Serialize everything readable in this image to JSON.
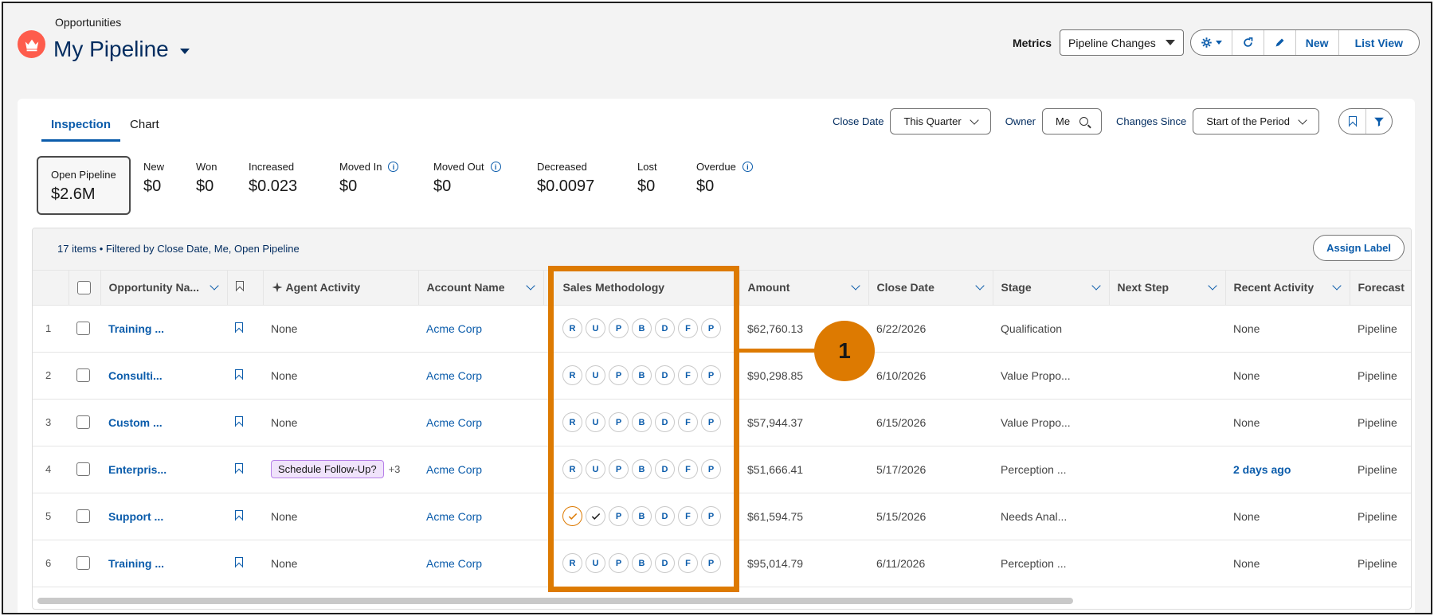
{
  "header": {
    "breadcrumb": "Opportunities",
    "title": "My Pipeline",
    "metrics_label": "Metrics",
    "metrics_value": "Pipeline Changes",
    "new_label": "New",
    "list_view_label": "List View"
  },
  "tabs": [
    {
      "label": "Inspection",
      "active": true
    },
    {
      "label": "Chart",
      "active": false
    }
  ],
  "filters": {
    "close_date_label": "Close Date",
    "close_date_value": "This Quarter",
    "owner_label": "Owner",
    "owner_value": "Me",
    "changes_since_label": "Changes Since",
    "changes_since_value": "Start of the Period"
  },
  "kpis": [
    {
      "label": "Open Pipeline",
      "value": "$2.6M"
    },
    {
      "label": "New",
      "value": "$0"
    },
    {
      "label": "Won",
      "value": "$0"
    },
    {
      "label": "Increased",
      "value": "$0.023"
    },
    {
      "label": "Moved In",
      "value": "$0"
    },
    {
      "label": "Moved Out",
      "value": "$0"
    },
    {
      "label": "Decreased",
      "value": "$0.0097"
    },
    {
      "label": "Lost",
      "value": "$0"
    },
    {
      "label": "Overdue",
      "value": "$0"
    }
  ],
  "table": {
    "summary": "17 items • Filtered by Close Date, Me, Open Pipeline",
    "assign_label": "Assign Label",
    "columns": {
      "opp_name": "Opportunity Na...",
      "agent_activity": "Agent Activity",
      "account_name": "Account Name",
      "sales_methodology": "Sales Methodology",
      "amount": "Amount",
      "close_date": "Close Date",
      "stage": "Stage",
      "next_step": "Next Step",
      "recent_activity": "Recent Activity",
      "forecast": "Forecast"
    },
    "methodology_letters": [
      "R",
      "U",
      "P",
      "B",
      "D",
      "F",
      "P"
    ],
    "rows": [
      {
        "num": "1",
        "name": "Training ...",
        "agent": "None",
        "account": "Acme Corp",
        "amount": "$62,760.13",
        "close": "6/22/2026",
        "stage": "Qualification",
        "recent": "None",
        "forecast": "Pipeline"
      },
      {
        "num": "2",
        "name": "Consulti...",
        "agent": "None",
        "account": "Acme Corp",
        "amount": "$90,298.85",
        "close": "6/10/2026",
        "stage": "Value Propo...",
        "recent": "None",
        "forecast": "Pipeline"
      },
      {
        "num": "3",
        "name": "Custom ...",
        "agent": "None",
        "account": "Acme Corp",
        "amount": "$57,944.37",
        "close": "6/15/2026",
        "stage": "Value Propo...",
        "recent": "None",
        "forecast": "Pipeline"
      },
      {
        "num": "4",
        "name": "Enterpris...",
        "agent_tag": "Schedule Follow-Up?",
        "agent_more": "+3",
        "account": "Acme Corp",
        "amount": "$51,666.41",
        "close": "5/17/2026",
        "stage": "Perception ...",
        "recent": "2 days ago",
        "forecast": "Pipeline"
      },
      {
        "num": "5",
        "name": "Support ...",
        "agent": "None",
        "account": "Acme Corp",
        "amount": "$61,594.75",
        "close": "5/15/2026",
        "stage": "Needs Anal...",
        "recent": "None",
        "forecast": "Pipeline"
      },
      {
        "num": "6",
        "name": "Training ...",
        "agent": "None",
        "account": "Acme Corp",
        "amount": "$95,014.79",
        "close": "6/11/2026",
        "stage": "Perception ...",
        "recent": "None",
        "forecast": "Pipeline"
      }
    ]
  },
  "callout": {
    "number": "1"
  },
  "colors": {
    "accent": "#0b5cab",
    "callout": "#dd7a01",
    "brand": "#fe5c4c"
  }
}
